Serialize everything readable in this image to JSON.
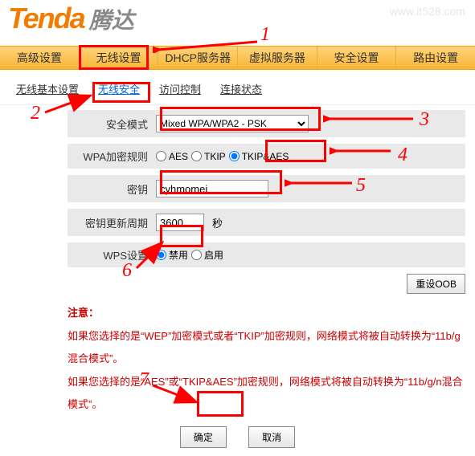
{
  "watermark": "www.it528.com",
  "logo": {
    "text": "Tenda",
    "sub": "腾达"
  },
  "nav": {
    "items": [
      "高级设置",
      "无线设置",
      "DHCP服务器",
      "虚拟服务器",
      "安全设置",
      "路由设置"
    ]
  },
  "tabs": {
    "items": [
      "无线基本设置",
      "无线安全",
      "访问控制",
      "连接状态"
    ],
    "active_index": 1
  },
  "form": {
    "security_mode": {
      "label": "安全模式",
      "value": "Mixed WPA/WPA2 - PSK"
    },
    "wpa_rule": {
      "label": "WPA加密规则",
      "options": [
        "AES",
        "TKIP",
        "TKIP&AES"
      ],
      "selected": "TKIP&AES"
    },
    "key": {
      "label": "密钥",
      "value": "cyhmomei"
    },
    "rekey": {
      "label": "密钥更新周期",
      "value": "3600",
      "unit": "秒"
    },
    "wps": {
      "label": "WPS设置",
      "options": [
        "禁用",
        "启用"
      ],
      "selected": "禁用"
    },
    "reset_btn": "重设OOB"
  },
  "note": {
    "title": "注意：",
    "p1": "如果您选择的是“WEP”加密模式或者“TKIP”加密规则，网络模式将被自动转换为“11b/g混合模式”。",
    "p2": "如果您选择的是“AES”或“TKIP&AES”加密规则，网络模式将被自动转换为“11b/g/n混合模式”。"
  },
  "actions": {
    "ok": "确定",
    "cancel": "取消"
  },
  "callouts": {
    "n1": "1",
    "n2": "2",
    "n3": "3",
    "n4": "4",
    "n5": "5",
    "n6": "6",
    "n7": "7"
  }
}
